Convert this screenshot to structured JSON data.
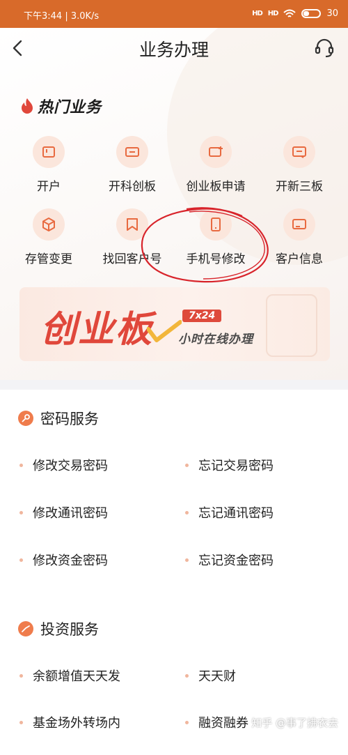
{
  "status_bar": {
    "left_text": "下午3:44 | 3.0K/s",
    "signal1": "HD",
    "signal2": "HD",
    "battery": "30"
  },
  "header": {
    "title": "业务办理"
  },
  "hot": {
    "title": "热门业务",
    "items": [
      {
        "label": "开户",
        "icon": "card-icon"
      },
      {
        "label": "开科创板",
        "icon": "board-icon"
      },
      {
        "label": "创业板申请",
        "icon": "apply-icon"
      },
      {
        "label": "开新三板",
        "icon": "transfer-icon"
      },
      {
        "label": "存管变更",
        "icon": "box-icon"
      },
      {
        "label": "找回客户号",
        "icon": "bookmark-icon"
      },
      {
        "label": "手机号修改",
        "icon": "phone-icon"
      },
      {
        "label": "客户信息",
        "icon": "profile-icon"
      }
    ]
  },
  "banner": {
    "title": "创业板",
    "badge": "7x24",
    "subtitle": "小时在线办理"
  },
  "password_services": {
    "title": "密码服务",
    "items": [
      "修改交易密码",
      "忘记交易密码",
      "修改通讯密码",
      "忘记通讯密码",
      "修改资金密码",
      "忘记资金密码"
    ]
  },
  "investment_services": {
    "title": "投资服务",
    "items": [
      "余额增值天天发",
      "天天财",
      "基金场外转场内",
      "融资融券"
    ]
  },
  "watermark": "知乎 @事了拂衣去",
  "colors": {
    "accent": "#e0473b",
    "icon_bg": "#fbe6dc",
    "icon_stroke": "#e86a40",
    "status_bar": "#d86a2a"
  }
}
